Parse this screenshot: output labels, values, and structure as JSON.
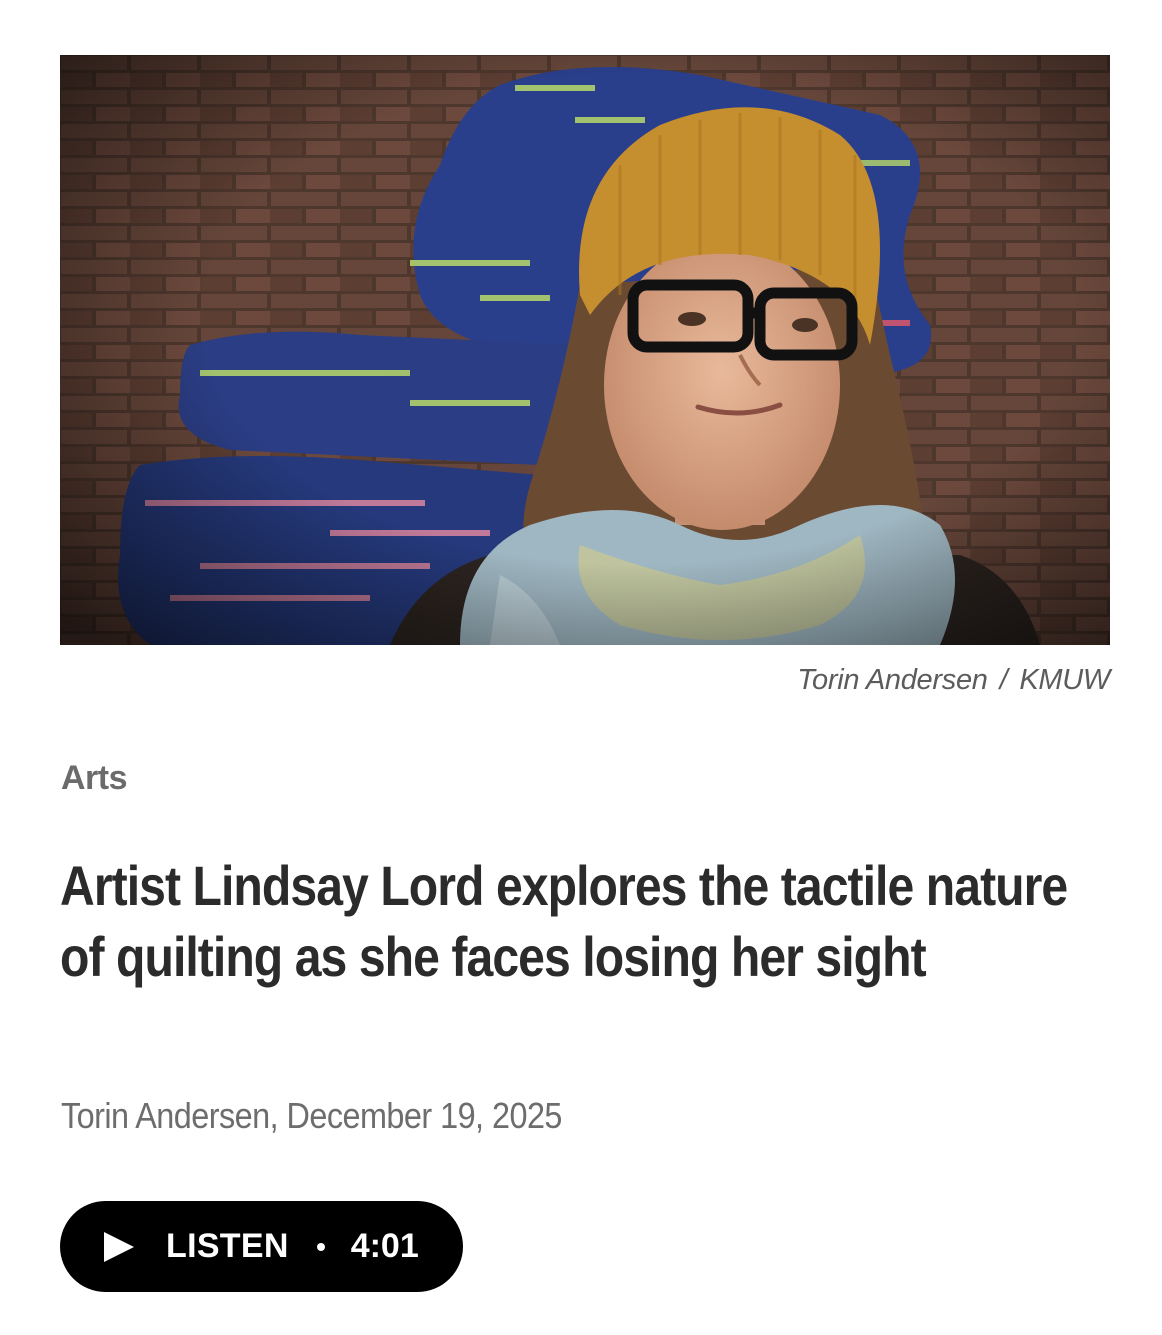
{
  "photo": {
    "description_icon": "portrait-photo",
    "credit_author": "Torin Andersen",
    "credit_separator": "/",
    "credit_org": "KMUW"
  },
  "article": {
    "section": "Arts",
    "headline": "Artist Lindsay Lord explores the tactile nature of quilting as she faces losing her sight",
    "byline": "Torin Andersen, December 19, 2025"
  },
  "listen": {
    "label": "LISTEN",
    "duration": "4:01",
    "icon": "play-icon"
  },
  "colors": {
    "text_dark": "#2b2b2b",
    "text_muted": "#6d6d6d",
    "pill_bg": "#000000",
    "pill_fg": "#ffffff"
  }
}
